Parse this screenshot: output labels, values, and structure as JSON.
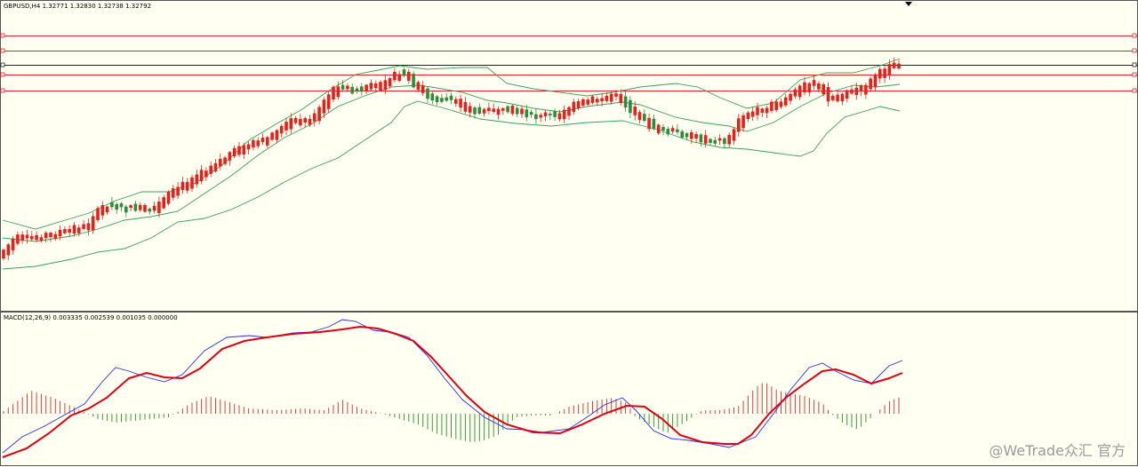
{
  "header": {
    "price_label": "GBPUSD,H4  1.32771 1.32830 1.32738 1.32792",
    "macd_label": "MACD(12,26,9) 0.003335 0.002539 0.001035 0.000000"
  },
  "watermark": "@WeTrade众汇 官方",
  "colors": {
    "background": "#fffff2",
    "bull_candle": "#e8201a",
    "bear_candle": "#2e8b3a",
    "bollinger": "#3aa05a",
    "hline_red": "#e4202a",
    "hline_black": "#222222",
    "macd_line": "#2a2aff",
    "signal_line": "#e00010",
    "hist_pos": "#d84040",
    "hist_neg": "#3a9a3a"
  },
  "chart_data": {
    "type": "candlestick",
    "symbol": "GBPUSD",
    "timeframe": "H4",
    "last_ohlc": {
      "open": 1.32771,
      "high": 1.3283,
      "low": 1.32738,
      "close": 1.32792
    },
    "macd": {
      "fast": 12,
      "slow": 26,
      "signal": 9,
      "values": [
        0.003335,
        0.002539,
        0.001035,
        0.0
      ]
    },
    "indicators": [
      "Bollinger Bands",
      "MACD"
    ]
  }
}
